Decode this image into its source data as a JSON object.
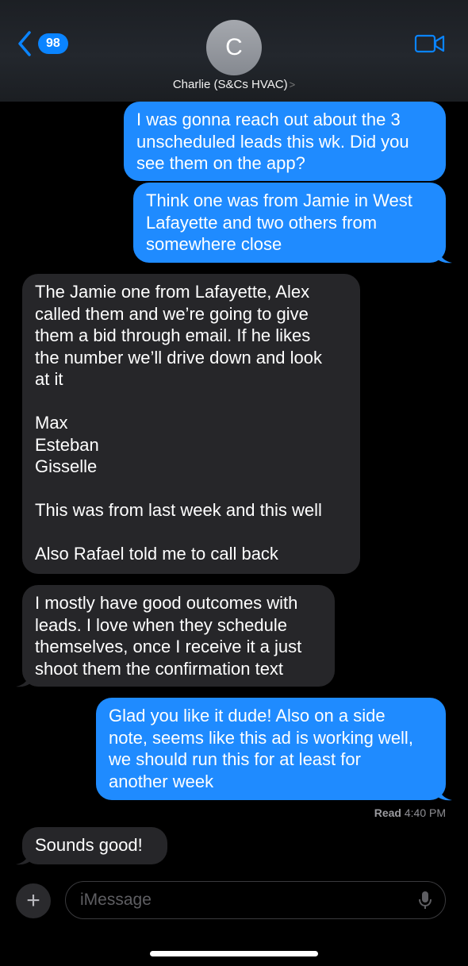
{
  "header": {
    "back_count": "98",
    "avatar_initial": "C",
    "contact_name": "Charlie (S&Cs HVAC)",
    "contact_arrow": ">"
  },
  "messages": [
    {
      "sender": "me",
      "lines": [
        "I was gonna reach out about the 3",
        "unscheduled leads this wk. Did you",
        "see them on the app?"
      ]
    },
    {
      "sender": "me",
      "lines": [
        "Think one was from Jamie in West",
        "Lafayette and two others from",
        "somewhere close"
      ]
    },
    {
      "sender": "them",
      "lines": [
        "The Jamie one from Lafayette, Alex",
        "called them and we’re going to give",
        "them a bid through email. If he likes",
        "the number we’ll drive down and look",
        "at it",
        "",
        "Max",
        "Esteban",
        "Gisselle",
        "",
        "This was from last week and this well",
        "",
        "Also Rafael told me to call back"
      ]
    },
    {
      "sender": "them",
      "lines": [
        "I mostly have good outcomes with",
        "leads. I love when they schedule",
        "themselves, once I receive it a just",
        "shoot them the confirmation text"
      ]
    },
    {
      "sender": "me",
      "lines": [
        "Glad you like it dude! Also on a side",
        "note, seems like this ad is working well,",
        "we should run this for at least for",
        "another week"
      ]
    },
    {
      "sender": "them",
      "lines": [
        "Sounds good!"
      ]
    }
  ],
  "receipt": {
    "label": "Read",
    "time": "4:40 PM"
  },
  "composer": {
    "placeholder": "iMessage",
    "plus_symbol": "+"
  },
  "colors": {
    "outgoing": "#1f8bff",
    "incoming": "#262629",
    "accent": "#0a84ff"
  }
}
